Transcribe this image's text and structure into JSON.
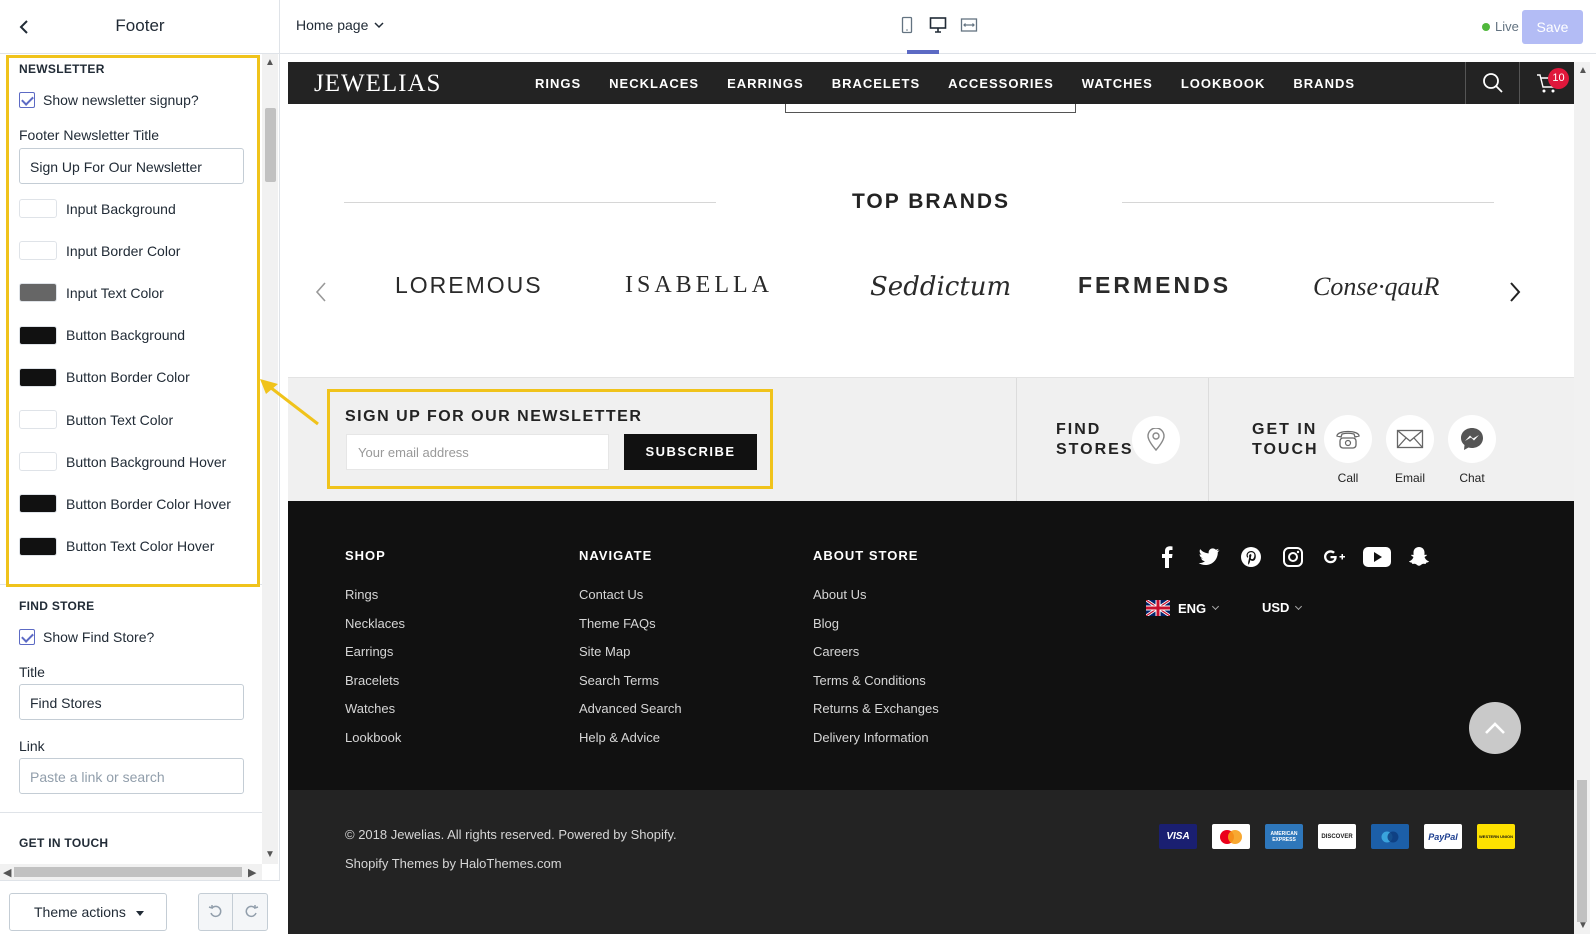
{
  "sidebar": {
    "title": "Footer",
    "newsletter": {
      "section_title": "NEWSLETTER",
      "show_label": "Show newsletter signup?",
      "title_label": "Footer Newsletter Title",
      "title_value": "Sign Up For Our Newsletter",
      "swatches": [
        {
          "label": "Input Background",
          "color": "#ffffff"
        },
        {
          "label": "Input Border Color",
          "color": "#ffffff"
        },
        {
          "label": "Input Text Color",
          "color": "#666666"
        },
        {
          "label": "Button Background",
          "color": "#111111"
        },
        {
          "label": "Button Border Color",
          "color": "#111111"
        },
        {
          "label": "Button Text Color",
          "color": "#ffffff"
        },
        {
          "label": "Button Background Hover",
          "color": "#ffffff"
        },
        {
          "label": "Button Border Color Hover",
          "color": "#111111"
        },
        {
          "label": "Button Text Color Hover",
          "color": "#111111"
        }
      ]
    },
    "find_store": {
      "section_title": "FIND STORE",
      "show_label": "Show Find Store?",
      "title_label": "Title",
      "title_value": "Find Stores",
      "link_label": "Link",
      "link_placeholder": "Paste a link or search"
    },
    "get_in_touch_title": "GET IN TOUCH",
    "theme_actions": "Theme actions"
  },
  "topbar": {
    "page_selector": "Home page",
    "live_label": "Live",
    "save_label": "Save"
  },
  "store": {
    "logo": "JEWELIAS",
    "menu": [
      "RINGS",
      "NECKLACES",
      "EARRINGS",
      "BRACELETS",
      "ACCESSORIES",
      "WATCHES",
      "LOOKBOOK",
      "BRANDS"
    ],
    "cart_count": "10",
    "brands_title": "TOP BRANDS",
    "brands": [
      "LOREMOUS",
      "ISABELLA",
      "Seddictum",
      "FERMENDS",
      "Conse·qauR"
    ],
    "newsletter": {
      "title": "SIGN UP FOR OUR NEWSLETTER",
      "placeholder": "Your email address",
      "button": "SUBSCRIBE"
    },
    "find_stores": "FIND STORES",
    "get_in_touch": "GET IN TOUCH",
    "contacts": [
      "Call",
      "Email",
      "Chat"
    ],
    "footer": {
      "shop": {
        "title": "SHOP",
        "links": [
          "Rings",
          "Necklaces",
          "Earrings",
          "Bracelets",
          "Watches",
          "Lookbook"
        ]
      },
      "navigate": {
        "title": "NAVIGATE",
        "links": [
          "Contact Us",
          "Theme FAQs",
          "Site Map",
          "Search Terms",
          "Advanced Search",
          "Help & Advice"
        ]
      },
      "about": {
        "title": "ABOUT STORE",
        "links": [
          "About Us",
          "Blog",
          "Careers",
          "Terms & Conditions",
          "Returns & Exchanges",
          "Delivery Information"
        ]
      },
      "language": "ENG",
      "currency": "USD",
      "social_icons": [
        "facebook-icon",
        "twitter-icon",
        "pinterest-icon",
        "instagram-icon",
        "google-plus-icon",
        "youtube-icon",
        "snapchat-icon"
      ]
    },
    "copyright": "© 2018 Jewelias. All rights reserved. Powered by Shopify.",
    "credit": "Shopify Themes by HaloThemes.com",
    "payments": [
      "VISA",
      "mastercard",
      "AMERICAN EXPRESS",
      "DISCOVER",
      "maestro",
      "PayPal",
      "WESTERN UNION"
    ]
  },
  "colors": {
    "highlight": "#f0c31b",
    "accent": "#5c6ac4",
    "save_disabled": "#b3bcf5",
    "live_dot": "#50b83c"
  }
}
